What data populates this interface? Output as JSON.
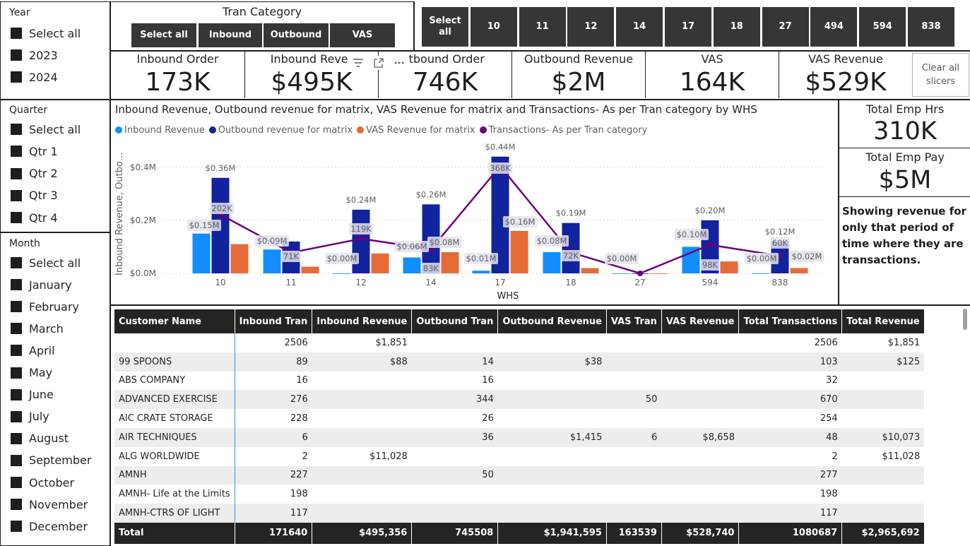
{
  "year_slicer": {
    "title": "Year",
    "items": [
      "Select all",
      "2023",
      "2024"
    ]
  },
  "quarter_slicer": {
    "title": "Quarter",
    "items": [
      "Select all",
      "Qtr 1",
      "Qtr 2",
      "Qtr 3",
      "Qtr 4"
    ]
  },
  "month_slicer": {
    "title": "Month",
    "items": [
      "Select all",
      "January",
      "February",
      "March",
      "April",
      "May",
      "June",
      "July",
      "August",
      "September",
      "October",
      "November",
      "December"
    ]
  },
  "tran_category": {
    "title": "Tran Category",
    "buttons": [
      "Select all",
      "Inbound",
      "Outbound",
      "VAS"
    ]
  },
  "whs_slicer": {
    "buttons": [
      "Select all",
      "10",
      "11",
      "12",
      "14",
      "17",
      "18",
      "27",
      "494",
      "594",
      "838"
    ]
  },
  "kpis": [
    {
      "title": "Inbound Order",
      "value": "173K"
    },
    {
      "title": "Inbound Rever",
      "value": "$495K"
    },
    {
      "title": "ıtbound Order",
      "value": "746K"
    },
    {
      "title": "Outbound Revenue",
      "value": "$2M"
    },
    {
      "title": "VAS",
      "value": "164K"
    },
    {
      "title": "VAS Revenue",
      "value": "$529K"
    }
  ],
  "clear_slicers": "Clear all slicers",
  "emp_hrs": {
    "title": "Total Emp Hrs",
    "value": "310K"
  },
  "emp_pay": {
    "title": "Total Emp Pay",
    "value": "$5M"
  },
  "note": "Showing revenue for only that period of time where they are transactions.",
  "colors": {
    "inbound": "#118dff",
    "outbound": "#12239e",
    "vas": "#e66c37",
    "transactions": "#6b007b",
    "dark": "#252423"
  },
  "chart_data": {
    "type": "bar",
    "title": "Inbound Revenue, Outbound revenue for matrix, VAS Revenue for matrix and Transactions- As per Tran category by WHS",
    "xlabel": "WHS",
    "ylabel": "Inbound Revenue, Outbo...",
    "categories": [
      "10",
      "11",
      "12",
      "14",
      "17",
      "18",
      "27",
      "594",
      "838"
    ],
    "y_ticks": [
      "$0.0M",
      "$0.2M",
      "$0.4M"
    ],
    "ylim": [
      0,
      0.45
    ],
    "series": [
      {
        "name": "Inbound Revenue",
        "values": [
          0.15,
          0.09,
          0.0,
          0.06,
          0.01,
          0.08,
          0.0,
          0.1,
          0.0
        ],
        "labels": [
          "$0.15M",
          "$0.09M",
          "$0.00M",
          "$0.06M",
          "$0.01M",
          "$0.08M",
          "$0.00M",
          "$0.10M",
          "$0.00M"
        ]
      },
      {
        "name": "Outbound revenue for matrix",
        "values": [
          0.36,
          0.12,
          0.24,
          0.26,
          0.44,
          0.19,
          0.0,
          0.2,
          0.12
        ],
        "labels": [
          "$0.36M",
          "",
          "$0.24M",
          "$0.26M",
          "$0.44M",
          "$0.19M",
          "",
          "$0.20M",
          "$0.12M"
        ]
      },
      {
        "name": "VAS Revenue for matrix",
        "values": [
          0.11,
          0.025,
          0.075,
          0.08,
          0.16,
          0.02,
          0.0,
          0.045,
          0.02
        ],
        "labels": [
          "",
          "",
          "",
          "$0.08M",
          "$0.16M",
          "",
          "",
          "",
          "$0.02M"
        ]
      },
      {
        "name": "Transactions- As per Tran category",
        "values": [
          202,
          71,
          119,
          83,
          368,
          72,
          0,
          98,
          60
        ],
        "labels": [
          "202K",
          "71K",
          "119K",
          "83K",
          "368K",
          "72K",
          "",
          "98K",
          "60K"
        ],
        "axis": "secondary",
        "ylim": [
          0,
          410
        ],
        "type": "line"
      }
    ],
    "legend": "top-left"
  },
  "table": {
    "headers": [
      "Customer Name",
      "Inbound Tran",
      "Inbound Revenue",
      "Outbound Tran",
      "Outbound Revenue",
      "VAS Tran",
      "VAS Revenue",
      "Total Transactions",
      "Total Revenue"
    ],
    "rows": [
      [
        "",
        "2506",
        "$1,851",
        "",
        "",
        "",
        "",
        "2506",
        "$1,851"
      ],
      [
        "99 SPOONS",
        "89",
        "$88",
        "14",
        "$38",
        "",
        "",
        "103",
        "$125"
      ],
      [
        "ABS COMPANY",
        "16",
        "",
        "16",
        "",
        "",
        "",
        "32",
        ""
      ],
      [
        "ADVANCED EXERCISE",
        "276",
        "",
        "344",
        "",
        "50",
        "",
        "670",
        ""
      ],
      [
        "AIC CRATE STORAGE",
        "228",
        "",
        "26",
        "",
        "",
        "",
        "254",
        ""
      ],
      [
        "AIR TECHNIQUES",
        "6",
        "",
        "36",
        "$1,415",
        "6",
        "$8,658",
        "48",
        "$10,073"
      ],
      [
        "ALG WORLDWIDE",
        "2",
        "$11,028",
        "",
        "",
        "",
        "",
        "2",
        "$11,028"
      ],
      [
        "AMNH",
        "227",
        "",
        "50",
        "",
        "",
        "",
        "277",
        ""
      ],
      [
        "AMNH- Life at the Limits",
        "198",
        "",
        "",
        "",
        "",
        "",
        "198",
        ""
      ],
      [
        "AMNH-CTRS OF LIGHT",
        "117",
        "",
        "",
        "",
        "",
        "",
        "117",
        ""
      ]
    ],
    "total": [
      "Total",
      "171640",
      "$495,356",
      "745508",
      "$1,941,595",
      "163539",
      "$528,740",
      "1080687",
      "$2,965,692"
    ]
  }
}
